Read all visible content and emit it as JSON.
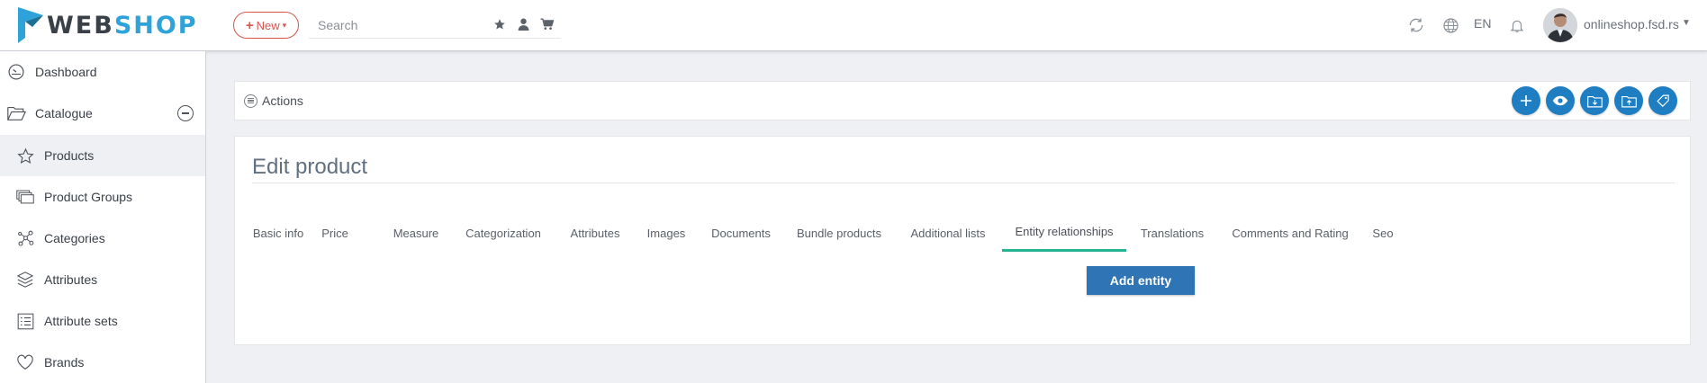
{
  "brand": {
    "part1": "WEB",
    "part2": "SHOP",
    "color_primary": "#3a4048",
    "color_accent": "#2ea3d9"
  },
  "header": {
    "new_label": "New",
    "search_placeholder": "Search",
    "language": "EN",
    "user_name": "onlineshop.fsd.rs",
    "icons": [
      "star-icon",
      "user-icon",
      "cart-icon",
      "refresh-icon",
      "globe-icon",
      "bell-icon"
    ]
  },
  "sidebar": {
    "items": [
      {
        "label": "Dashboard",
        "icon": "speedometer-icon"
      },
      {
        "label": "Catalogue",
        "icon": "folder-open-icon"
      },
      {
        "label": "Products",
        "icon": "star-outline-icon",
        "active": true
      },
      {
        "label": "Product Groups",
        "icon": "stack-icon"
      },
      {
        "label": "Categories",
        "icon": "network-icon"
      },
      {
        "label": "Attributes",
        "icon": "layers-icon"
      },
      {
        "label": "Attribute sets",
        "icon": "list-icon"
      },
      {
        "label": "Brands",
        "icon": "heart-icon"
      }
    ]
  },
  "actions": {
    "label": "Actions",
    "buttons": [
      "add-icon",
      "preview-icon",
      "folder-import-icon",
      "folder-export-icon",
      "tags-icon"
    ],
    "color": "#1f7ec1"
  },
  "main": {
    "title": "Edit product",
    "tabs": [
      {
        "label": "Basic info"
      },
      {
        "label": "Price"
      },
      {
        "label": "Measure"
      },
      {
        "label": "Categorization"
      },
      {
        "label": "Attributes"
      },
      {
        "label": "Images"
      },
      {
        "label": "Documents"
      },
      {
        "label": "Bundle products"
      },
      {
        "label": "Additional lists"
      },
      {
        "label": "Entity relationships",
        "active": true
      },
      {
        "label": "Translations"
      },
      {
        "label": "Comments and Rating"
      },
      {
        "label": "Seo"
      }
    ],
    "active_tab_color": "#26b393",
    "add_button_label": "Add entity",
    "add_button_color": "#2f74b5"
  }
}
